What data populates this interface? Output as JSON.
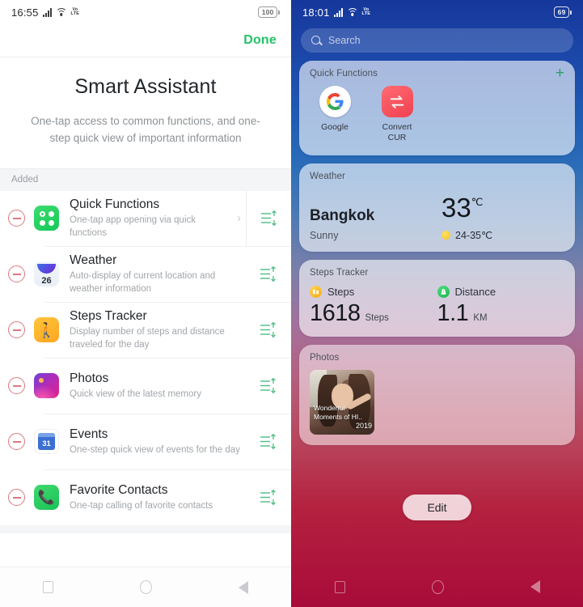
{
  "left": {
    "status": {
      "time": "16:55",
      "network": "VoLTE",
      "battery": "100"
    },
    "done_label": "Done",
    "title": "Smart Assistant",
    "subtitle": "One-tap access to common functions, and one-step quick view of important information",
    "section_label": "Added",
    "items": [
      {
        "title": "Quick Functions",
        "desc": "One-tap app opening via quick functions",
        "icon": "quick-functions-icon",
        "has_chevron": true
      },
      {
        "title": "Weather",
        "desc": "Auto-display of current location and weather information",
        "icon": "weather-icon",
        "badge": "26",
        "has_chevron": false
      },
      {
        "title": "Steps Tracker",
        "desc": "Display number of steps and distance traveled for the day",
        "icon": "steps-tracker-icon",
        "has_chevron": false
      },
      {
        "title": "Photos",
        "desc": "Quick view of the latest memory",
        "icon": "photos-icon",
        "has_chevron": false
      },
      {
        "title": "Events",
        "desc": "One-step quick view of events for the day",
        "icon": "events-icon",
        "badge": "31",
        "has_chevron": false
      },
      {
        "title": "Favorite Contacts",
        "desc": "One-tap calling of favorite contacts",
        "icon": "contacts-icon",
        "has_chevron": false
      }
    ]
  },
  "right": {
    "status": {
      "time": "18:01",
      "network": "VoLTE",
      "battery": "69"
    },
    "search": {
      "placeholder": "Search"
    },
    "quick_functions": {
      "title": "Quick Functions",
      "add_label": "+",
      "apps": [
        {
          "label": "Google",
          "icon": "google-icon"
        },
        {
          "label": "Convert CUR",
          "icon": "convert-currency-icon"
        }
      ]
    },
    "weather": {
      "title": "Weather",
      "city": "Bangkok",
      "condition": "Sunny",
      "temp": "33",
      "temp_unit": "℃",
      "range": "24-35℃"
    },
    "steps": {
      "title": "Steps Tracker",
      "steps_label": "Steps",
      "steps_value": "1618",
      "steps_unit": "Steps",
      "distance_label": "Distance",
      "distance_value": "1.1",
      "distance_unit": "KM"
    },
    "photos": {
      "title": "Photos",
      "caption_line1": "Wonderful",
      "caption_line2": "Moments of HI..",
      "caption_year": "2019"
    },
    "edit_label": "Edit"
  },
  "colors": {
    "accent_green": "#23c268",
    "remove_red": "#e0777f",
    "plus_green": "#2d9f66"
  }
}
